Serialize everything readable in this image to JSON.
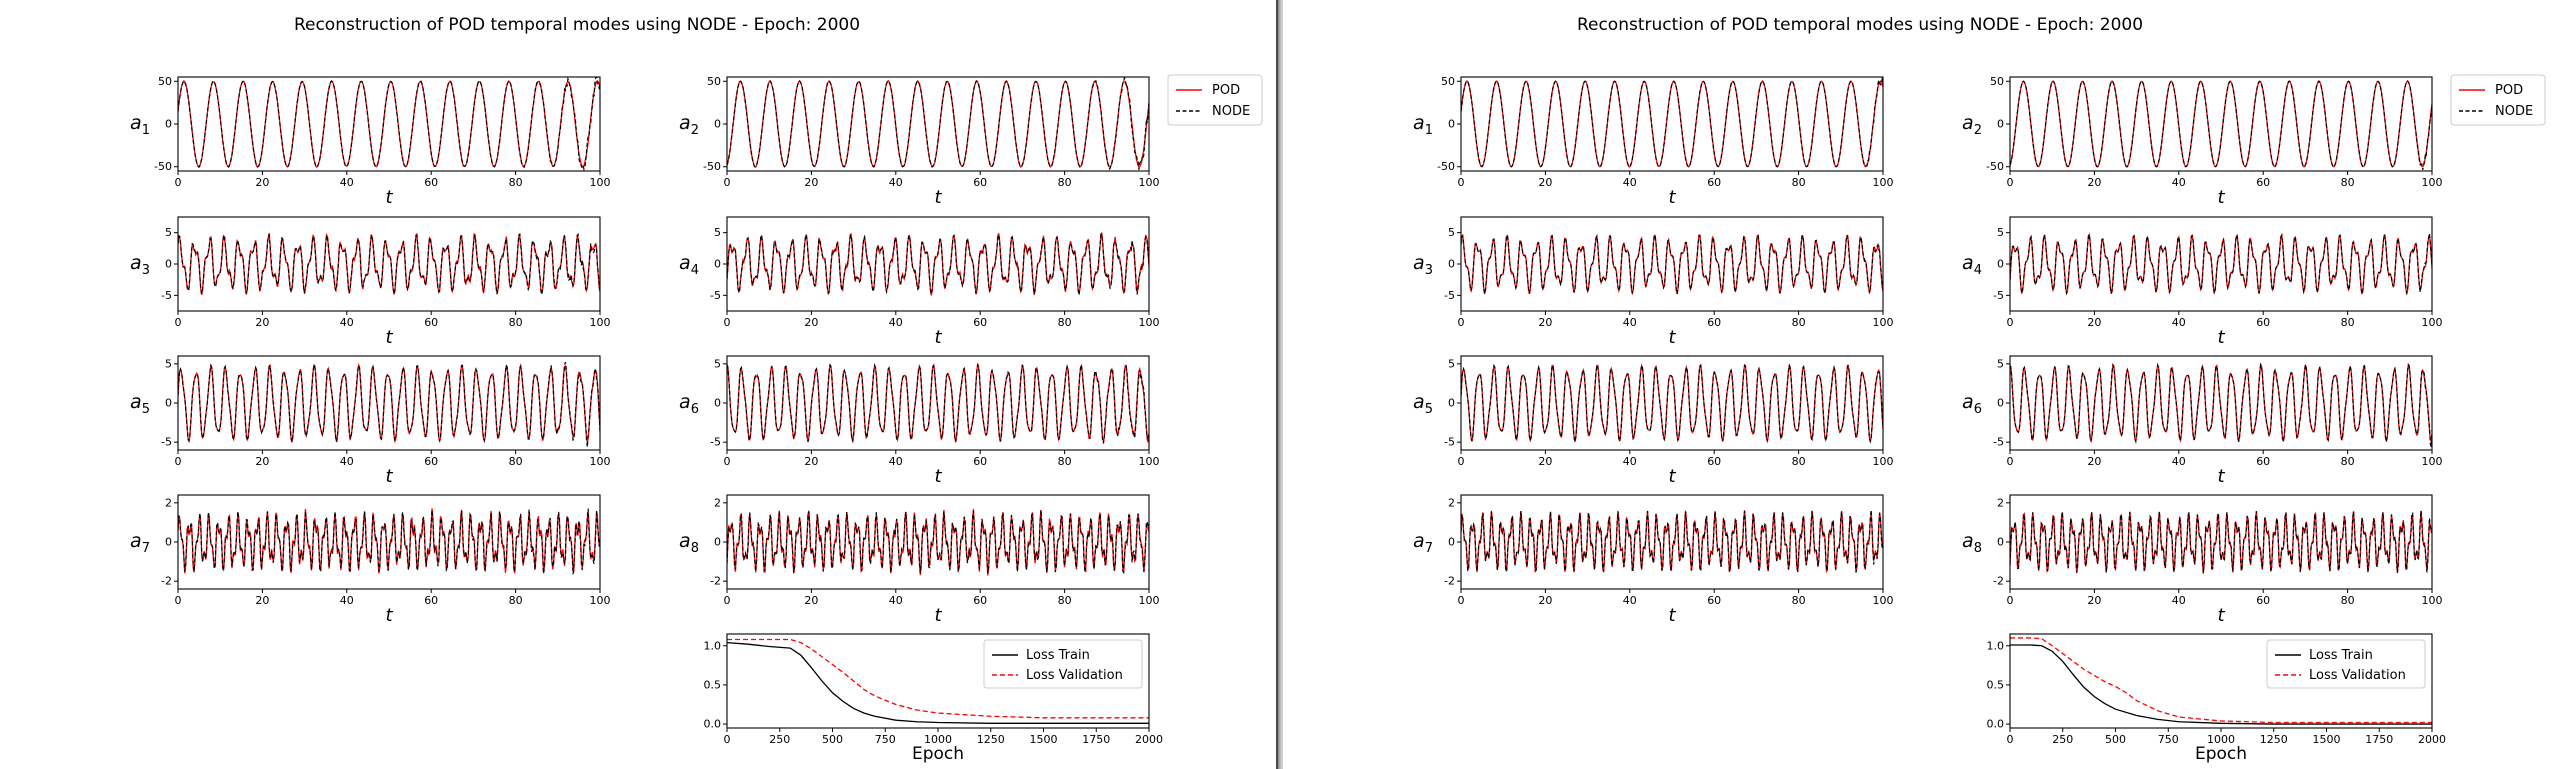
{
  "window": {
    "panels": [
      {
        "id": "left",
        "title": "Reconstruction of POD temporal modes using NODE - Epoch:  2000"
      },
      {
        "id": "right",
        "title": "Reconstruction of POD temporal modes using NODE - Epoch:  2000"
      }
    ]
  },
  "chart_data": [
    {
      "panel": "left",
      "title": "Reconstruction of POD temporal modes using NODE - Epoch:  2000",
      "legend": [
        "POD",
        "NODE"
      ],
      "colors": {
        "POD": "#ff0000",
        "NODE": "#000000"
      },
      "subplots": [
        {
          "type": "line",
          "ylabel": "a1",
          "ylabel_base": "a",
          "ylabel_sub": "1",
          "xlabel": "t",
          "xlim": [
            0,
            100
          ],
          "ylim": [
            -55,
            55
          ],
          "yticks": [
            -50,
            0,
            50
          ],
          "xticks": [
            0,
            20,
            40,
            60,
            80,
            100
          ],
          "amplitude": 50,
          "period": 7.0,
          "phase": 0.3,
          "harmonic": 0.0,
          "noise": 1.5,
          "drift_after": 80
        },
        {
          "type": "line",
          "ylabel": "a2",
          "ylabel_base": "a",
          "ylabel_sub": "2",
          "xlabel": "t",
          "xlim": [
            0,
            100
          ],
          "ylim": [
            -55,
            55
          ],
          "yticks": [
            -50,
            0,
            50
          ],
          "xticks": [
            0,
            20,
            40,
            60,
            80,
            100
          ],
          "amplitude": 50,
          "period": 7.0,
          "phase": -1.3,
          "harmonic": 0.0,
          "noise": 1.5,
          "drift_after": 85
        },
        {
          "type": "line",
          "ylabel": "a3",
          "ylabel_base": "a",
          "ylabel_sub": "3",
          "xlabel": "t",
          "xlim": [
            0,
            100
          ],
          "ylim": [
            -7.5,
            7.5
          ],
          "yticks": [
            -5,
            0,
            5
          ],
          "xticks": [
            0,
            20,
            40,
            60,
            80,
            100
          ],
          "amplitude": 4.5,
          "period": 3.5,
          "phase": 0.8,
          "harmonic": 0.5,
          "noise": 0.8,
          "drift_after": 70
        },
        {
          "type": "line",
          "ylabel": "a4",
          "ylabel_base": "a",
          "ylabel_sub": "4",
          "xlabel": "t",
          "xlim": [
            0,
            100
          ],
          "ylim": [
            -7.5,
            7.5
          ],
          "yticks": [
            -5,
            0,
            5
          ],
          "xticks": [
            0,
            20,
            40,
            60,
            80,
            100
          ],
          "amplitude": 4.5,
          "period": 3.5,
          "phase": -0.6,
          "harmonic": 0.5,
          "noise": 0.8,
          "drift_after": 70
        },
        {
          "type": "line",
          "ylabel": "a5",
          "ylabel_base": "a",
          "ylabel_sub": "5",
          "xlabel": "t",
          "xlim": [
            0,
            100
          ],
          "ylim": [
            -6,
            6
          ],
          "yticks": [
            -5,
            0,
            5
          ],
          "xticks": [
            0,
            20,
            40,
            60,
            80,
            100
          ],
          "amplitude": 4.8,
          "period": 3.5,
          "phase": 0.2,
          "harmonic": 0.25,
          "noise": 0.3,
          "drift_after": 80
        },
        {
          "type": "line",
          "ylabel": "a6",
          "ylabel_base": "a",
          "ylabel_sub": "6",
          "xlabel": "t",
          "xlim": [
            0,
            100
          ],
          "ylim": [
            -6,
            6
          ],
          "yticks": [
            -5,
            0,
            5
          ],
          "xticks": [
            0,
            20,
            40,
            60,
            80,
            100
          ],
          "amplitude": 4.8,
          "period": 3.5,
          "phase": 1.6,
          "harmonic": 0.25,
          "noise": 0.3,
          "drift_after": 80
        },
        {
          "type": "line",
          "ylabel": "a7",
          "ylabel_base": "a",
          "ylabel_sub": "7",
          "xlabel": "t",
          "xlim": [
            0,
            100
          ],
          "ylim": [
            -2.4,
            2.4
          ],
          "yticks": [
            -2,
            0,
            2
          ],
          "xticks": [
            0,
            20,
            40,
            60,
            80,
            100
          ],
          "amplitude": 1.5,
          "period": 2.3,
          "phase": 0.4,
          "harmonic": 0.6,
          "noise": 0.35,
          "drift_after": 65
        },
        {
          "type": "line",
          "ylabel": "a8",
          "ylabel_base": "a",
          "ylabel_sub": "8",
          "xlabel": "t",
          "xlim": [
            0,
            100
          ],
          "ylim": [
            -2.4,
            2.4
          ],
          "yticks": [
            -2,
            0,
            2
          ],
          "xticks": [
            0,
            20,
            40,
            60,
            80,
            100
          ],
          "amplitude": 1.5,
          "period": 2.3,
          "phase": -0.9,
          "harmonic": 0.6,
          "noise": 0.35,
          "drift_after": 65
        }
      ],
      "loss": {
        "type": "line",
        "xlabel": "Epoch",
        "xlim": [
          0,
          2000
        ],
        "ylim": [
          -0.05,
          1.15
        ],
        "xticks": [
          0,
          250,
          500,
          750,
          1000,
          1250,
          1500,
          1750,
          2000
        ],
        "yticks": [
          0.0,
          0.5,
          1.0
        ],
        "legend": [
          "Loss Train",
          "Loss Validation"
        ],
        "train": {
          "name": "Loss Train",
          "x": [
            0,
            100,
            200,
            300,
            350,
            400,
            450,
            500,
            550,
            600,
            650,
            700,
            800,
            900,
            1000,
            1250,
            1500,
            1750,
            2000
          ],
          "y": [
            1.04,
            1.02,
            0.99,
            0.97,
            0.88,
            0.72,
            0.55,
            0.4,
            0.29,
            0.2,
            0.14,
            0.1,
            0.05,
            0.03,
            0.02,
            0.01,
            0.01,
            0.01,
            0.01
          ]
        },
        "validation": {
          "name": "Loss Validation",
          "x": [
            0,
            100,
            200,
            300,
            350,
            400,
            450,
            500,
            550,
            600,
            650,
            700,
            800,
            900,
            1000,
            1250,
            1500,
            1750,
            2000
          ],
          "y": [
            1.08,
            1.08,
            1.08,
            1.08,
            1.04,
            0.96,
            0.86,
            0.76,
            0.66,
            0.55,
            0.44,
            0.36,
            0.25,
            0.18,
            0.14,
            0.1,
            0.08,
            0.08,
            0.08
          ]
        }
      }
    },
    {
      "panel": "right",
      "title": "Reconstruction of POD temporal modes using NODE - Epoch:  2000",
      "legend": [
        "POD",
        "NODE"
      ],
      "colors": {
        "POD": "#ff0000",
        "NODE": "#000000"
      },
      "subplots": [
        {
          "type": "line",
          "ylabel": "a1",
          "ylabel_base": "a",
          "ylabel_sub": "1",
          "xlabel": "t",
          "xlim": [
            0,
            100
          ],
          "ylim": [
            -55,
            55
          ],
          "yticks": [
            -50,
            0,
            50
          ],
          "xticks": [
            0,
            20,
            40,
            60,
            80,
            100
          ],
          "amplitude": 50,
          "period": 7.0,
          "phase": 0.3,
          "harmonic": 0.0,
          "noise": 0.6,
          "drift_after": 95
        },
        {
          "type": "line",
          "ylabel": "a2",
          "ylabel_base": "a",
          "ylabel_sub": "2",
          "xlabel": "t",
          "xlim": [
            0,
            100
          ],
          "ylim": [
            -55,
            55
          ],
          "yticks": [
            -50,
            0,
            50
          ],
          "xticks": [
            0,
            20,
            40,
            60,
            80,
            100
          ],
          "amplitude": 50,
          "period": 7.0,
          "phase": -1.3,
          "harmonic": 0.0,
          "noise": 0.6,
          "drift_after": 95
        },
        {
          "type": "line",
          "ylabel": "a3",
          "ylabel_base": "a",
          "ylabel_sub": "3",
          "xlabel": "t",
          "xlim": [
            0,
            100
          ],
          "ylim": [
            -7.5,
            7.5
          ],
          "yticks": [
            -5,
            0,
            5
          ],
          "xticks": [
            0,
            20,
            40,
            60,
            80,
            100
          ],
          "amplitude": 4.5,
          "period": 3.5,
          "phase": 0.8,
          "harmonic": 0.5,
          "noise": 0.3,
          "drift_after": 92
        },
        {
          "type": "line",
          "ylabel": "a4",
          "ylabel_base": "a",
          "ylabel_sub": "4",
          "xlabel": "t",
          "xlim": [
            0,
            100
          ],
          "ylim": [
            -7.5,
            7.5
          ],
          "yticks": [
            -5,
            0,
            5
          ],
          "xticks": [
            0,
            20,
            40,
            60,
            80,
            100
          ],
          "amplitude": 4.5,
          "period": 3.5,
          "phase": -0.6,
          "harmonic": 0.5,
          "noise": 0.3,
          "drift_after": 92
        },
        {
          "type": "line",
          "ylabel": "a5",
          "ylabel_base": "a",
          "ylabel_sub": "5",
          "xlabel": "t",
          "xlim": [
            0,
            100
          ],
          "ylim": [
            -6,
            6
          ],
          "yticks": [
            -5,
            0,
            5
          ],
          "xticks": [
            0,
            20,
            40,
            60,
            80,
            100
          ],
          "amplitude": 4.8,
          "period": 3.5,
          "phase": 0.2,
          "harmonic": 0.25,
          "noise": 0.15,
          "drift_after": 95
        },
        {
          "type": "line",
          "ylabel": "a6",
          "ylabel_base": "a",
          "ylabel_sub": "6",
          "xlabel": "t",
          "xlim": [
            0,
            100
          ],
          "ylim": [
            -6,
            6
          ],
          "yticks": [
            -5,
            0,
            5
          ],
          "xticks": [
            0,
            20,
            40,
            60,
            80,
            100
          ],
          "amplitude": 4.8,
          "period": 3.5,
          "phase": 1.6,
          "harmonic": 0.25,
          "noise": 0.15,
          "drift_after": 95
        },
        {
          "type": "line",
          "ylabel": "a7",
          "ylabel_base": "a",
          "ylabel_sub": "7",
          "xlabel": "t",
          "xlim": [
            0,
            100
          ],
          "ylim": [
            -2.4,
            2.4
          ],
          "yticks": [
            -2,
            0,
            2
          ],
          "xticks": [
            0,
            20,
            40,
            60,
            80,
            100
          ],
          "amplitude": 1.5,
          "period": 2.3,
          "phase": 0.4,
          "harmonic": 0.6,
          "noise": 0.15,
          "drift_after": 90
        },
        {
          "type": "line",
          "ylabel": "a8",
          "ylabel_base": "a",
          "ylabel_sub": "8",
          "xlabel": "t",
          "xlim": [
            0,
            100
          ],
          "ylim": [
            -2.4,
            2.4
          ],
          "yticks": [
            -2,
            0,
            2
          ],
          "xticks": [
            0,
            20,
            40,
            60,
            80,
            100
          ],
          "amplitude": 1.5,
          "period": 2.3,
          "phase": -0.9,
          "harmonic": 0.6,
          "noise": 0.15,
          "drift_after": 90
        }
      ],
      "loss": {
        "type": "line",
        "xlabel": "Epoch",
        "xlim": [
          0,
          2000
        ],
        "ylim": [
          -0.05,
          1.15
        ],
        "xticks": [
          0,
          250,
          500,
          750,
          1000,
          1250,
          1500,
          1750,
          2000
        ],
        "yticks": [
          0.0,
          0.5,
          1.0
        ],
        "legend": [
          "Loss Train",
          "Loss Validation"
        ],
        "train": {
          "name": "Loss Train",
          "x": [
            0,
            100,
            150,
            200,
            250,
            300,
            350,
            400,
            450,
            500,
            600,
            700,
            800,
            1000,
            1250,
            1500,
            1750,
            2000
          ],
          "y": [
            1.01,
            1.01,
            1.0,
            0.93,
            0.8,
            0.63,
            0.47,
            0.35,
            0.26,
            0.19,
            0.11,
            0.06,
            0.03,
            0.01,
            0.0,
            0.0,
            0.0,
            0.0
          ]
        },
        "validation": {
          "name": "Loss Validation",
          "x": [
            0,
            100,
            150,
            200,
            250,
            300,
            350,
            400,
            450,
            500,
            550,
            600,
            700,
            800,
            1000,
            1250,
            1500,
            1750,
            2000
          ],
          "y": [
            1.1,
            1.1,
            1.09,
            1.0,
            0.9,
            0.8,
            0.7,
            0.62,
            0.54,
            0.48,
            0.4,
            0.3,
            0.17,
            0.09,
            0.04,
            0.02,
            0.02,
            0.02,
            0.02
          ]
        }
      }
    }
  ]
}
